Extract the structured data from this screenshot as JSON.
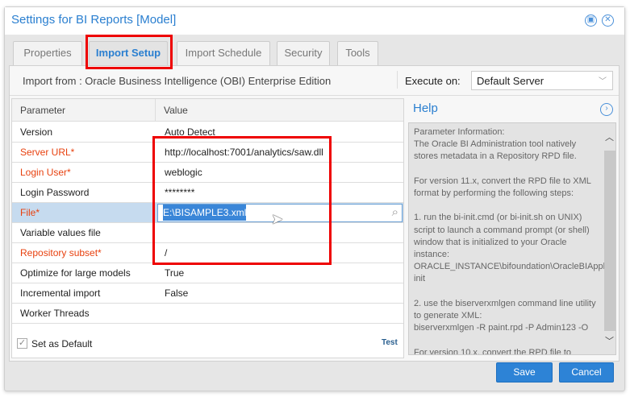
{
  "title": "Settings for BI Reports [Model]",
  "tabs": [
    "Properties",
    "Import Setup",
    "Import Schedule",
    "Security",
    "Tools"
  ],
  "import_from": "Import from : Oracle Business Intelligence (OBI) Enterprise Edition",
  "execute_on_label": "Execute on:",
  "execute_on_value": "Default Server",
  "grid": {
    "col_parameter": "Parameter",
    "col_value": "Value",
    "rows": [
      {
        "p": "Version",
        "v": "Auto Detect"
      },
      {
        "p": "Server URL*",
        "v": "http://localhost:7001/analytics/saw.dll"
      },
      {
        "p": "Login User*",
        "v": "weblogic"
      },
      {
        "p": "Login Password",
        "v": "********"
      },
      {
        "p": "File*",
        "v": "E:\\BISAMPLE3.xml"
      },
      {
        "p": "Variable values file",
        "v": ""
      },
      {
        "p": "Repository subset*",
        "v": "/"
      },
      {
        "p": "Optimize for large models",
        "v": "True"
      },
      {
        "p": "Incremental import",
        "v": "False"
      },
      {
        "p": "Worker Threads",
        "v": ""
      }
    ]
  },
  "set_default": "Set as Default",
  "test": "Test",
  "help": {
    "title": "Help",
    "text": "Parameter Information:\nThe Oracle BI Administration tool natively stores metadata in a Repository RPD file.\n\nFor version 11.x, convert the RPD file to XML format by performing the following steps:\n\n1. run the bi-init.cmd (or bi-init.sh on UNIX) script to launch a command prompt (or shell) window that is initialized to your Oracle instance:\nORACLE_INSTANCE\\bifoundation\\OracleBIApplication\\coreapplication\\setup\\bi-init\n\n2. use the biserverxmlgen command line utility to generate XML:\nbiserverxmlgen -R paint.rpd -P Admin123 -O\n\nFor version 10.x, convert the RPD file to"
  },
  "buttons": {
    "save": "Save",
    "cancel": "Cancel"
  }
}
